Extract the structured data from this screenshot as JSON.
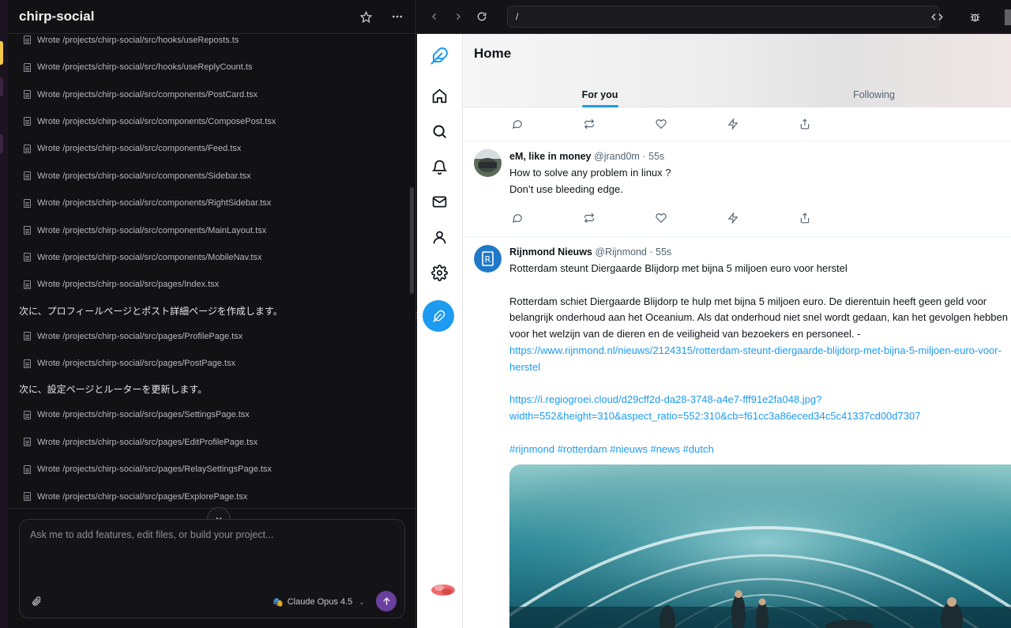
{
  "chat": {
    "title": "chirp-social",
    "log": [
      {
        "type": "file",
        "text": "Wrote /projects/chirp-social/src/hooks/useReposts.ts"
      },
      {
        "type": "file",
        "text": "Wrote /projects/chirp-social/src/hooks/useReplyCount.ts"
      },
      {
        "type": "file",
        "text": "Wrote /projects/chirp-social/src/components/PostCard.tsx"
      },
      {
        "type": "file",
        "text": "Wrote /projects/chirp-social/src/components/ComposePost.tsx"
      },
      {
        "type": "file",
        "text": "Wrote /projects/chirp-social/src/components/Feed.tsx"
      },
      {
        "type": "file",
        "text": "Wrote /projects/chirp-social/src/components/Sidebar.tsx"
      },
      {
        "type": "file",
        "text": "Wrote /projects/chirp-social/src/components/RightSidebar.tsx"
      },
      {
        "type": "file",
        "text": "Wrote /projects/chirp-social/src/components/MainLayout.tsx"
      },
      {
        "type": "file",
        "text": "Wrote /projects/chirp-social/src/components/MobileNav.tsx"
      },
      {
        "type": "file",
        "text": "Wrote /projects/chirp-social/src/pages/Index.tsx"
      },
      {
        "type": "msg",
        "text": "次に、プロフィールページとポスト詳細ページを作成します。"
      },
      {
        "type": "file",
        "text": "Wrote /projects/chirp-social/src/pages/ProfilePage.tsx"
      },
      {
        "type": "file",
        "text": "Wrote /projects/chirp-social/src/pages/PostPage.tsx"
      },
      {
        "type": "msg",
        "text": "次に、設定ページとルーターを更新します。"
      },
      {
        "type": "file",
        "text": "Wrote /projects/chirp-social/src/pages/SettingsPage.tsx"
      },
      {
        "type": "file",
        "text": "Wrote /projects/chirp-social/src/pages/EditProfilePage.tsx"
      },
      {
        "type": "file",
        "text": "Wrote /projects/chirp-social/src/pages/RelaySettingsPage.tsx"
      },
      {
        "type": "file",
        "text": "Wrote /projects/chirp-social/src/pages/ExplorePage.tsx"
      }
    ],
    "composer_placeholder": "Ask me to add features, edit files, or build your project...",
    "model_label": "Claude Opus 4.5",
    "model_emoji": "🎭"
  },
  "browser": {
    "url": "/"
  },
  "site": {
    "title": "Home",
    "tabs": [
      {
        "label": "For you",
        "active": true
      },
      {
        "label": "Following",
        "active": false
      }
    ],
    "posts": [
      {
        "name": "eM, like in money",
        "handle": "@jrand0m",
        "time": "55s",
        "text": "How to solve any problem in linux ?\nDon’t use bleeding edge."
      },
      {
        "name": "Rijnmond Nieuws",
        "handle": "@Rijnmond",
        "time": "55s",
        "text_intro": "Rotterdam steunt Diergaarde Blijdorp met bijna 5 miljoen euro voor herstel\n\nRotterdam schiet Diergaarde Blijdorp te hulp met bijna 5 miljoen euro. De dierentuin heeft geen geld voor belangrijk onderhoud aan het Oceanium. Als dat onderhoud niet snel wordt gedaan, kan het gevolgen hebben voor het welzijn van de dieren en de veiligheid van bezoekers en personeel. - ",
        "link1": "https://www.rijnmond.nl/nieuws/2124315/rotterdam-steunt-diergaarde-blijdorp-met-bijna-5-miljoen-euro-voor-herstel",
        "link2": "https://i.regiogroei.cloud/d29cff2d-da28-3748-a4e7-fff91e2fa048.jpg?width=552&height=310&aspect_ratio=552:310&cb=f61cc3a86eced34c5c41337cd00d7307",
        "hashtags": "#rijnmond #rotterdam #nieuws #news #dutch"
      }
    ]
  },
  "colors": {
    "accent": "#1d9bf0",
    "send_button": "#6b3f9e"
  }
}
